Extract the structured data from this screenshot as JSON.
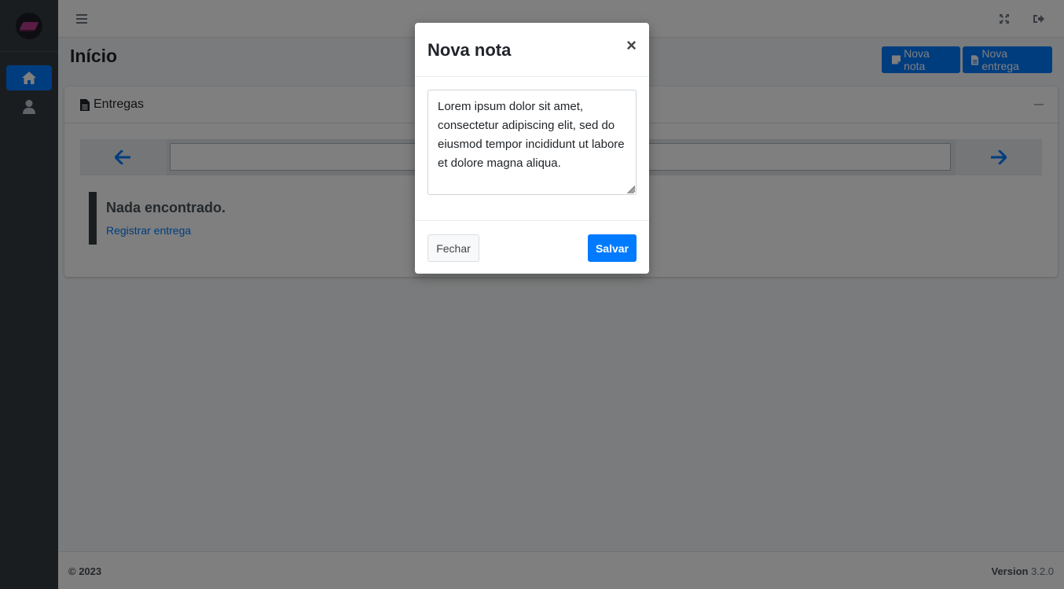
{
  "sidebar": {
    "items": [
      {
        "name": "home",
        "icon": "home-icon",
        "active": true
      },
      {
        "name": "user",
        "icon": "user-icon",
        "active": false
      }
    ]
  },
  "navbar": {
    "icons": [
      "menu-icon",
      "expand-icon",
      "logout-icon"
    ]
  },
  "header": {
    "title": "Início",
    "buttons": {
      "nova_nota": "Nova nota",
      "nova_entrega": "Nova entrega"
    }
  },
  "card": {
    "title": "Entregas",
    "search_value": "",
    "empty": {
      "title": "Nada encontrado.",
      "link": "Registrar entrega"
    }
  },
  "footer": {
    "copyright": "© 2023",
    "version_label": "Version",
    "version_number": "3.2.0"
  },
  "modal": {
    "title": "Nova nota",
    "close": "×",
    "note_text": "Lorem ipsum dolor sit amet, consectetur adipiscing elit, sed do eiusmod tempor incididunt ut labore et dolore magna aliqua.",
    "close_button": "Fechar",
    "save_button": "Salvar"
  },
  "colors": {
    "primary": "#007bff",
    "sidebar": "#343a40",
    "backdrop": "rgba(0,0,0,0.5)"
  }
}
